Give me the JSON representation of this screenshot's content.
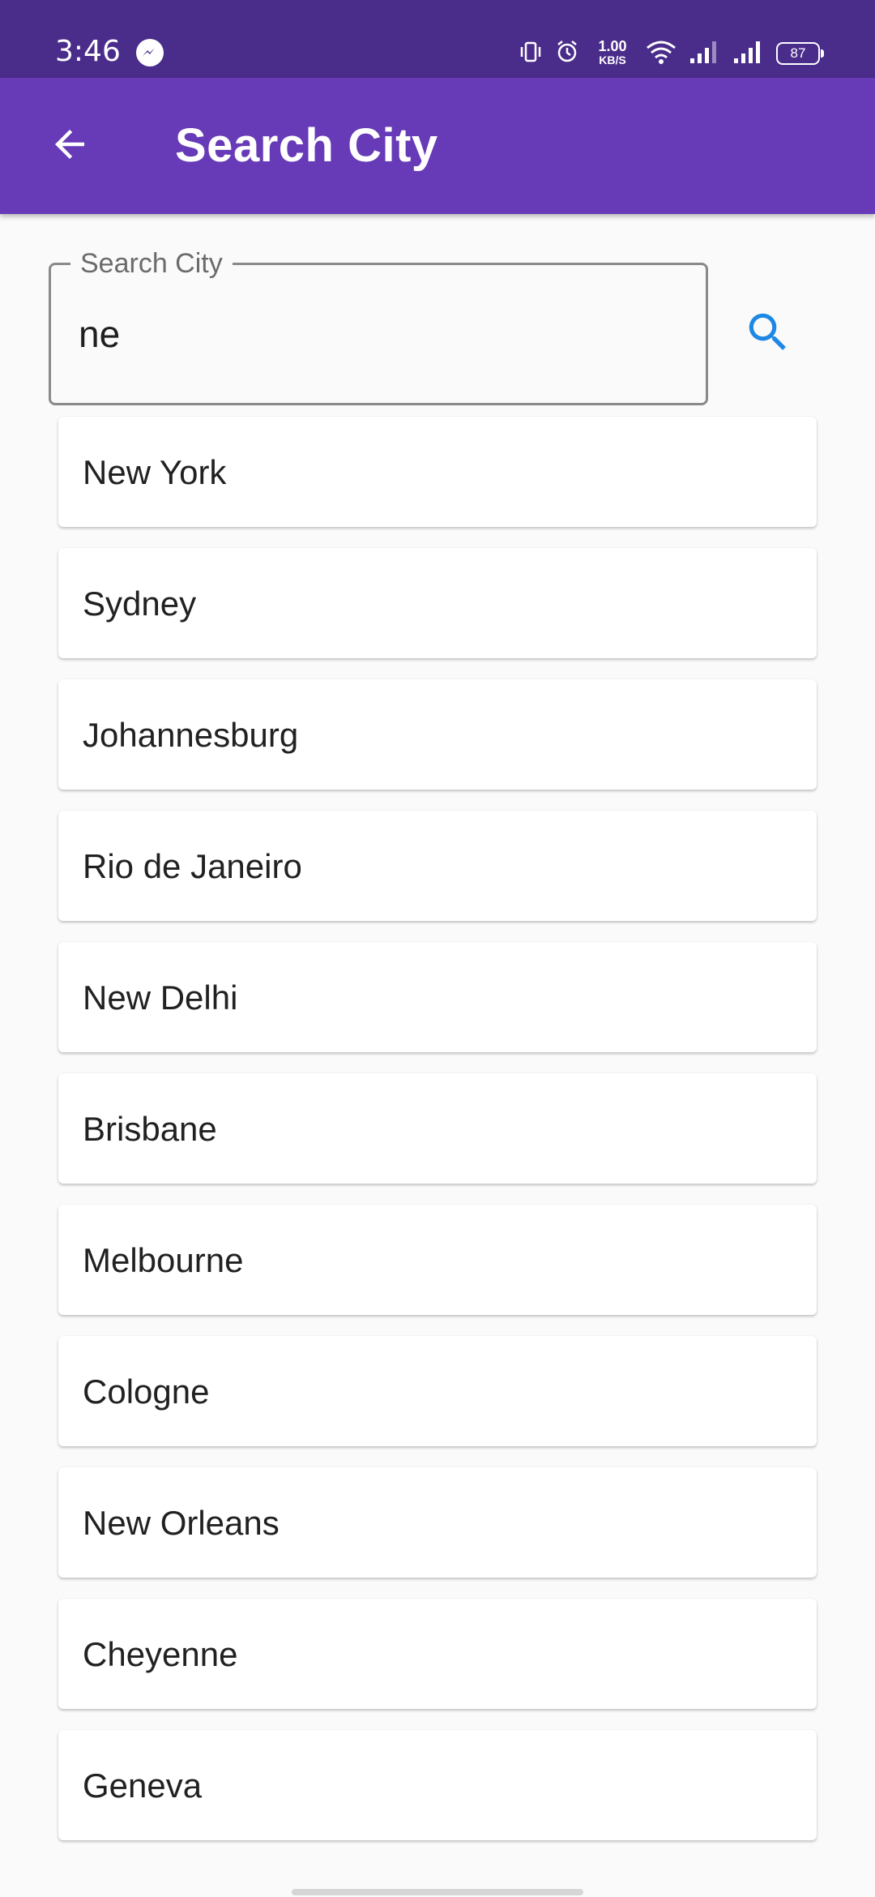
{
  "status_bar": {
    "time": "3:46",
    "net_speed_value": "1.00",
    "net_speed_unit": "KB/S",
    "battery": "87",
    "icons": [
      "messenger-icon",
      "vibrate-icon",
      "alarm-icon",
      "wifi-icon",
      "signal-icon",
      "signal-icon"
    ]
  },
  "app_bar": {
    "title": "Search City",
    "back_icon": "arrow-back-icon",
    "color": "#673ab7",
    "status_color": "#4a2c8a"
  },
  "search": {
    "label": "Search City",
    "value": "ne",
    "button_icon": "search-icon",
    "accent": "#1e88e5"
  },
  "results": [
    "New York",
    "Sydney",
    "Johannesburg",
    "Rio de Janeiro",
    "New Delhi",
    "Brisbane",
    "Melbourne",
    "Cologne",
    "New Orleans",
    "Cheyenne",
    "Geneva"
  ]
}
